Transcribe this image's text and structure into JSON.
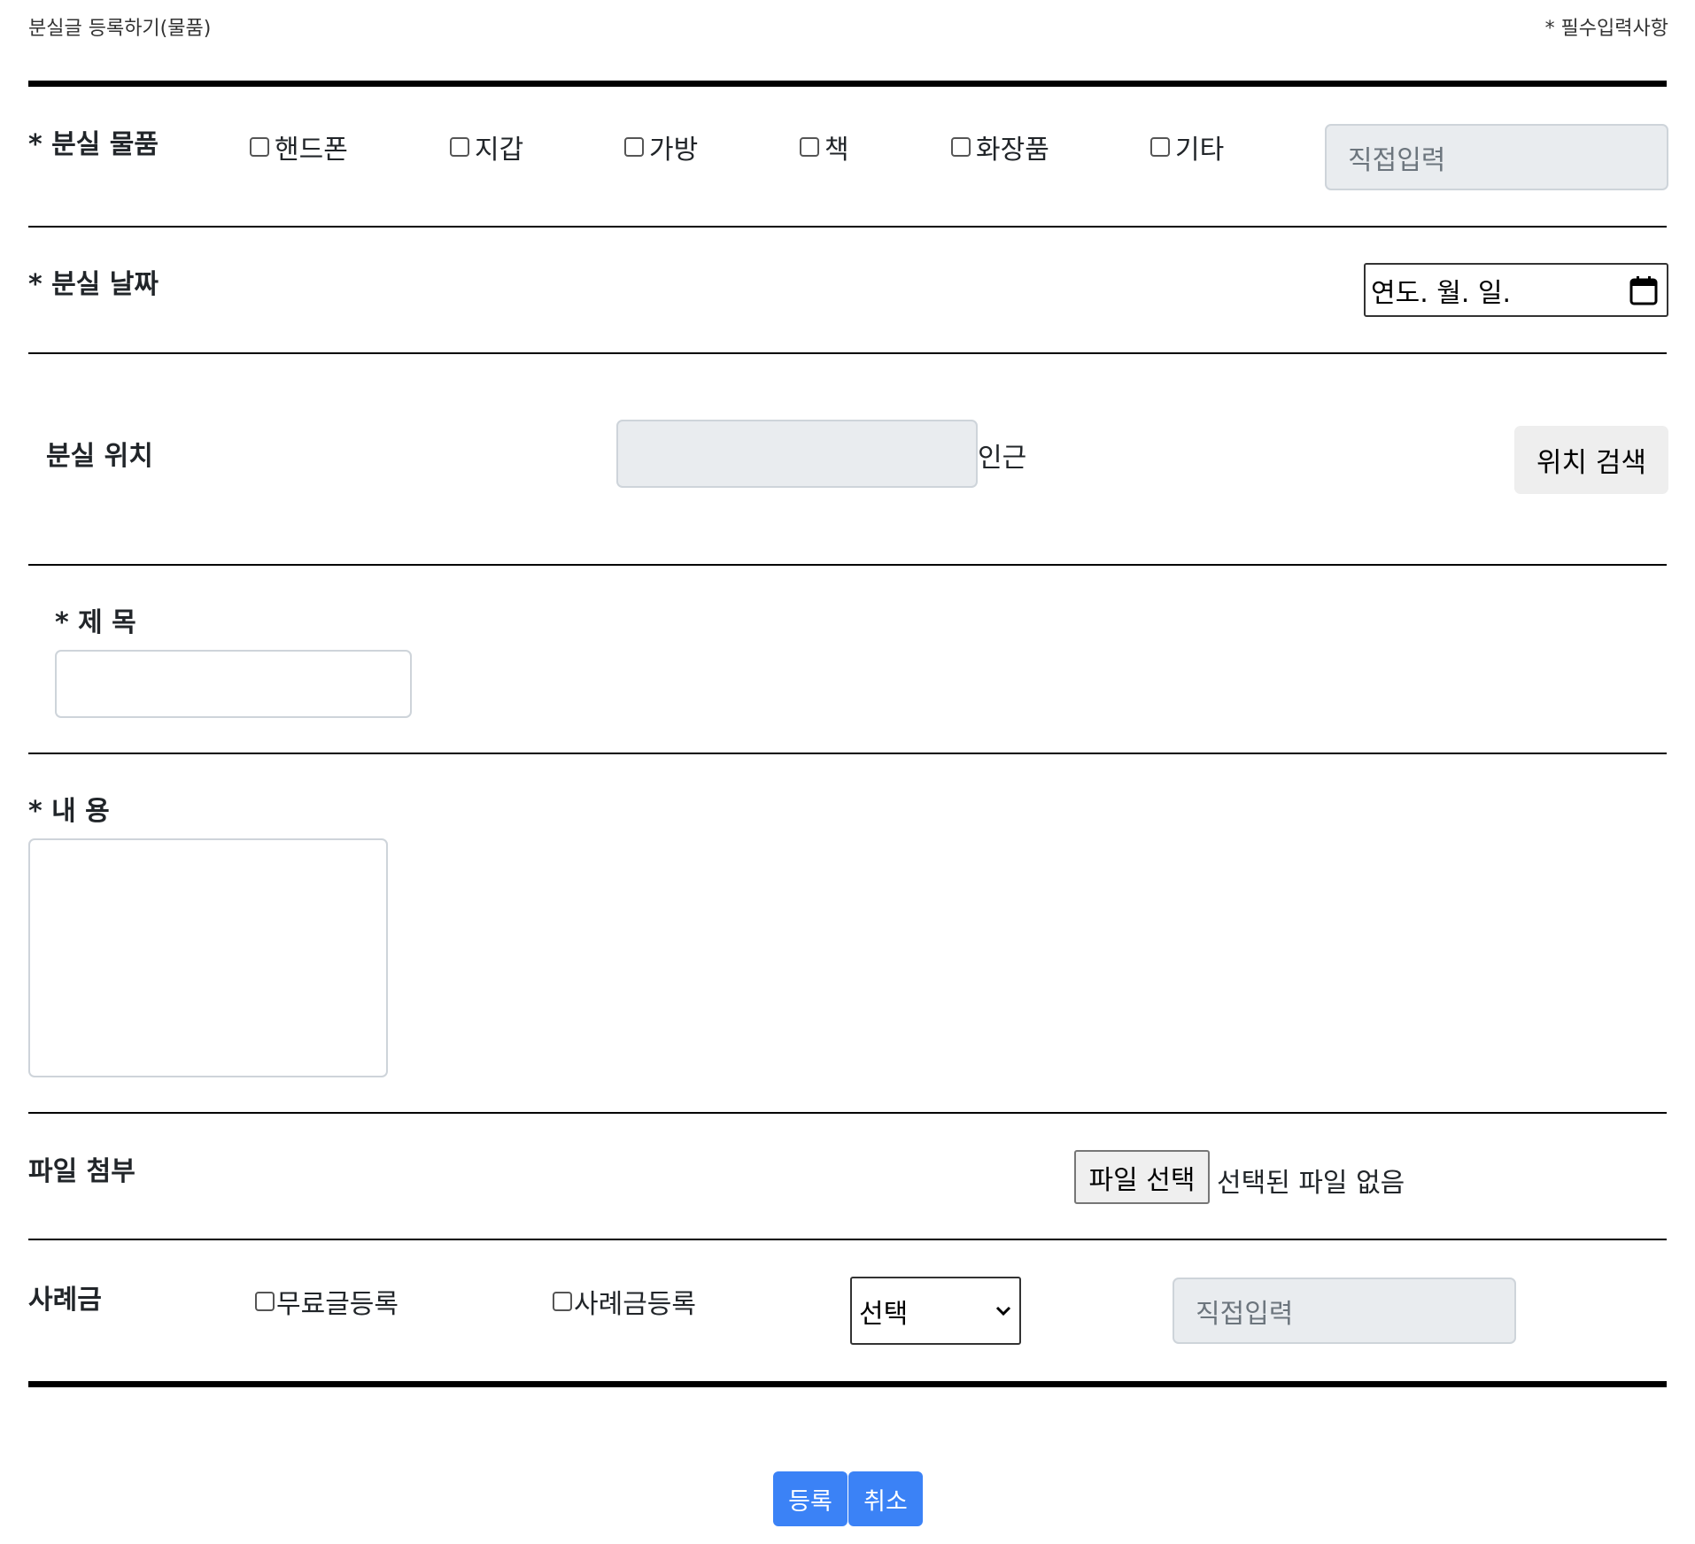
{
  "header": {
    "title": "분실글 등록하기(물품)",
    "required_note": "* 필수입력사항"
  },
  "lost_item": {
    "label": "* 분실 물품",
    "options": [
      "핸드폰",
      "지갑",
      "가방",
      "책",
      "화장품",
      "기타"
    ],
    "direct_input_placeholder": "직접입력"
  },
  "lost_date": {
    "label": "* 분실 날짜",
    "date_placeholder": "연도. 월. 일."
  },
  "lost_location": {
    "label": "분실 위치",
    "input_value": "",
    "nearby_label": "인근",
    "search_button": "위치 검색"
  },
  "title_field": {
    "label": "* 제 목",
    "value": ""
  },
  "content_field": {
    "label": "* 내 용",
    "value": ""
  },
  "attachment": {
    "label": "파일 첨부",
    "choose_button": "파일 선택",
    "status": "선택된 파일 없음"
  },
  "reward": {
    "label": "사례금",
    "free_label": "무료글등록",
    "reward_label": "사례금등록",
    "select_value": "선택",
    "direct_input_placeholder": "직접입력"
  },
  "actions": {
    "submit": "등록",
    "cancel": "취소"
  }
}
